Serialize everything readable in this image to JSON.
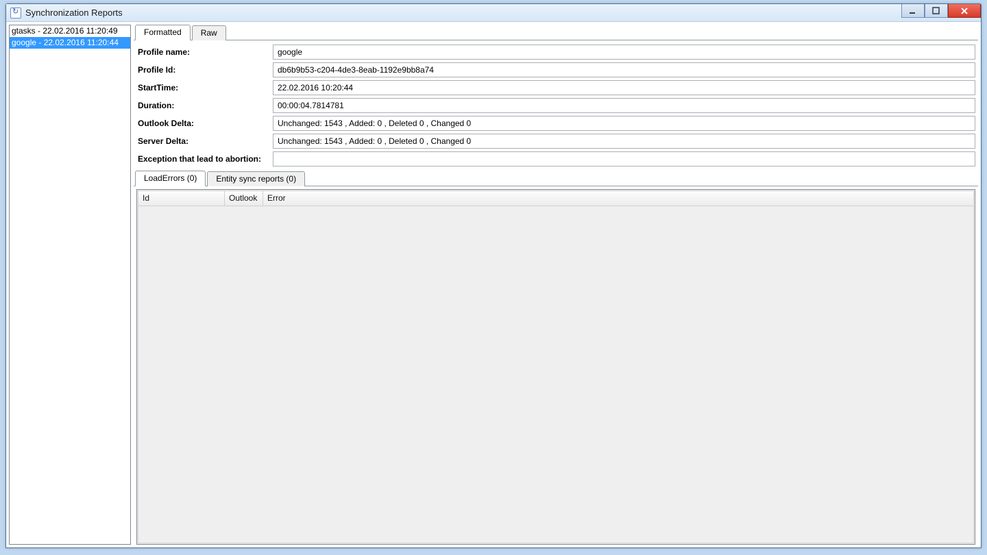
{
  "window": {
    "title": "Synchronization Reports"
  },
  "leftList": {
    "items": [
      {
        "label": "gtasks - 22.02.2016 11:20:49",
        "selected": false
      },
      {
        "label": "google - 22.02.2016 11:20:44",
        "selected": true
      }
    ]
  },
  "topTabs": {
    "items": [
      {
        "label": "Formatted",
        "active": true
      },
      {
        "label": "Raw",
        "active": false
      }
    ]
  },
  "details": {
    "labels": {
      "profileName": "Profile name:",
      "profileId": "Profile Id:",
      "startTime": "StartTime:",
      "duration": "Duration:",
      "outlookDelta": "Outlook Delta:",
      "serverDelta": "Server Delta:",
      "exception": "Exception that lead to abortion:"
    },
    "values": {
      "profileName": "google",
      "profileId": "db6b9b53-c204-4de3-8eab-1192e9bb8a74",
      "startTime": "22.02.2016 10:20:44",
      "duration": "00:00:04.7814781",
      "outlookDelta": "Unchanged: 1543 , Added: 0 , Deleted 0 ,  Changed 0",
      "serverDelta": "Unchanged: 1543 , Added: 0 , Deleted 0 ,  Changed 0",
      "exception": ""
    }
  },
  "subTabs": {
    "items": [
      {
        "label": "LoadErrors (0)",
        "active": true
      },
      {
        "label": "Entity sync reports (0)",
        "active": false
      }
    ]
  },
  "grid": {
    "columns": {
      "id": "Id",
      "outlook": "Outlook",
      "error": "Error"
    }
  }
}
